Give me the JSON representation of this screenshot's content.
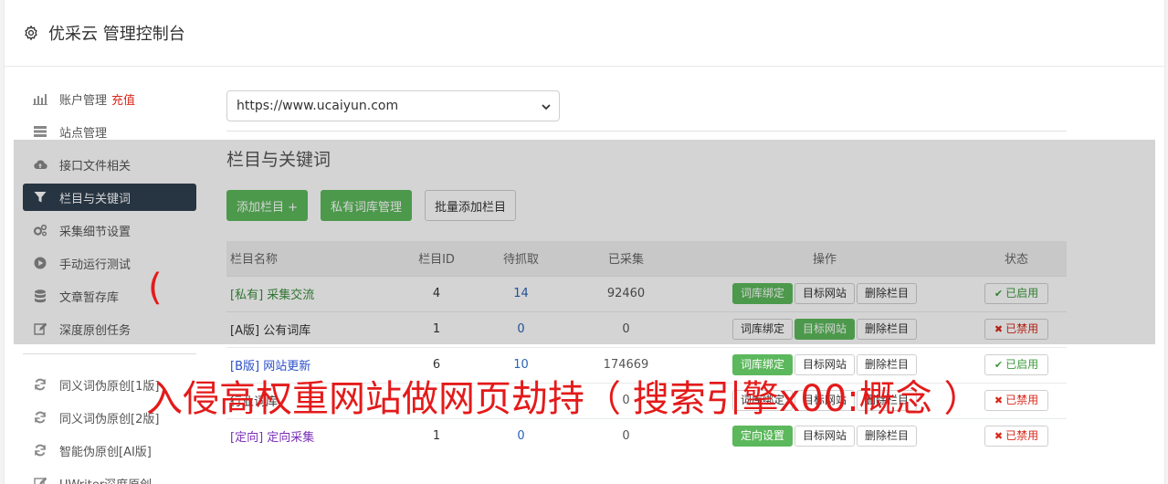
{
  "header": {
    "title": "优采云 管理控制台"
  },
  "sidebar": {
    "items": [
      {
        "label": "账户管理",
        "extra": "充值",
        "icon": "bar-chart-icon"
      },
      {
        "label": "站点管理",
        "icon": "server-icon"
      },
      {
        "label": "接口文件相关",
        "icon": "cloud-upload-icon"
      },
      {
        "label": "栏目与关键词",
        "icon": "filter-icon",
        "active": true
      },
      {
        "label": "采集细节设置",
        "icon": "cogs-icon"
      },
      {
        "label": "手动运行测试",
        "icon": "play-circle-icon"
      },
      {
        "label": "文章暂存库",
        "icon": "database-icon"
      },
      {
        "label": "深度原创任务",
        "icon": "edit-icon"
      }
    ],
    "items2": [
      {
        "label": "同义词伪原创[1版]",
        "icon": "refresh-icon"
      },
      {
        "label": "同义词伪原创[2版]",
        "icon": "refresh-icon"
      },
      {
        "label": "智能伪原创[AI版]",
        "icon": "refresh-icon"
      },
      {
        "label": "UWriter深度原创",
        "icon": "edit-icon"
      }
    ]
  },
  "main": {
    "site_select": "https://www.ucaiyun.com",
    "section_title": "栏目与关键词",
    "toolbar": {
      "add_column": "添加栏目 +",
      "private_lib": "私有词库管理",
      "batch_add": "批量添加栏目"
    },
    "table": {
      "headers": {
        "name": "栏目名称",
        "id": "栏目ID",
        "wait": "待抓取",
        "done": "已采集",
        "op": "操作",
        "status": "状态"
      },
      "rows": [
        {
          "tag": "[私有]",
          "name": "采集交流",
          "id": "4",
          "wait": "14",
          "done": "92460",
          "op1": "词库绑定",
          "op1_green": true,
          "op2": "目标网站",
          "op2_green": false,
          "op3": "删除栏目",
          "status": "已启用",
          "enabled": true,
          "tagclass": "tag-private"
        },
        {
          "tag": "[A版]",
          "name": "公有词库",
          "id": "1",
          "wait": "0",
          "done": "0",
          "op1": "词库绑定",
          "op1_green": false,
          "op2": "目标网站",
          "op2_green": true,
          "op3": "删除栏目",
          "status": "已禁用",
          "enabled": false,
          "tagclass": "tag-a"
        },
        {
          "tag": "[B版]",
          "name": "网站更新",
          "id": "6",
          "wait": "10",
          "done": "174669",
          "op1": "词库绑定",
          "op1_green": true,
          "op2": "目标网站",
          "op2_green": false,
          "op3": "删除栏目",
          "status": "已启用",
          "enabled": true,
          "tagclass": "tag-b"
        },
        {
          "tag": "",
          "name": "行业词库",
          "id": "",
          "wait": "",
          "done": "0",
          "op1": "词库绑定",
          "op1_green": false,
          "op2": "目标网站",
          "op2_green": false,
          "op3": "删除栏目",
          "status": "已禁用",
          "enabled": false,
          "tagclass": "tag-a"
        },
        {
          "tag": "[定向]",
          "name": "定向采集",
          "id": "1",
          "wait": "0",
          "done": "0",
          "op1": "定向设置",
          "op1_green": true,
          "op2": "目标网站",
          "op2_green": false,
          "op3": "删除栏目",
          "status": "已禁用",
          "enabled": false,
          "tagclass": "tag-dir"
        }
      ]
    }
  },
  "overlay_text": {
    "paren": "(",
    "banner": "入侵高权重网站做网页劫持（ 搜索引擎x00:概念 ）"
  },
  "colors": {
    "accent_green": "#5cb85c",
    "sidebar_active": "#2f4050",
    "danger": "#d9281b",
    "link_blue": "#2a63b8"
  }
}
